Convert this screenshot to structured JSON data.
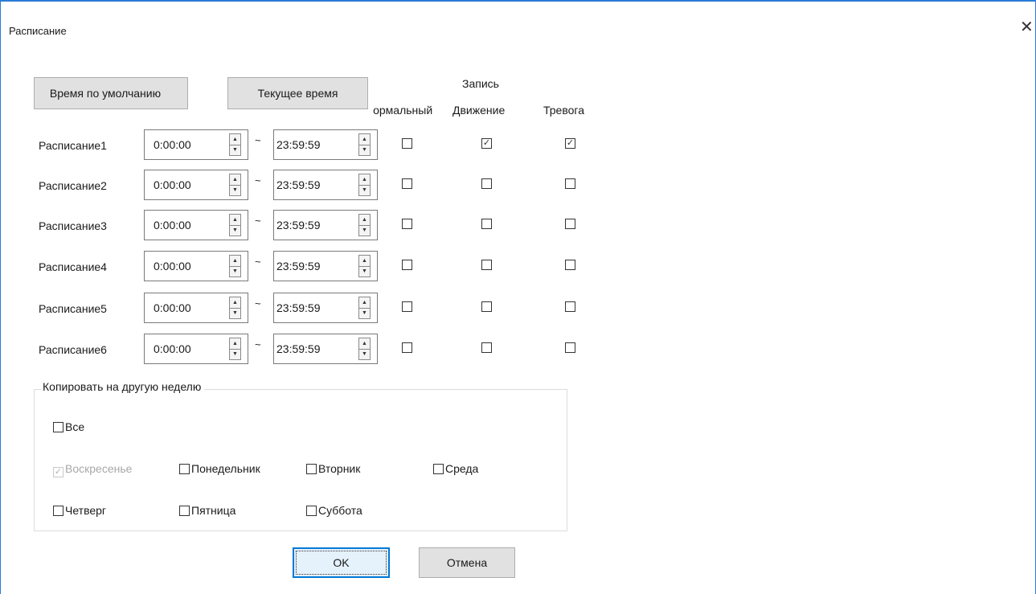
{
  "window": {
    "title": "Расписание",
    "close_glyph": "✕"
  },
  "buttons": {
    "default_time": "Время по умолчанию",
    "current_time": "Текущее время",
    "ok": "OK",
    "cancel": "Отмена"
  },
  "headers": {
    "record": "Запись",
    "normal": "Нормальный",
    "motion": "Движение",
    "alarm": "Тревога"
  },
  "separator": "~",
  "schedules": [
    {
      "label": "Расписание1",
      "start": "0:00:00",
      "end": "23:59:59",
      "normal": false,
      "motion": true,
      "alarm": true
    },
    {
      "label": "Расписание2",
      "start": "0:00:00",
      "end": "23:59:59",
      "normal": false,
      "motion": false,
      "alarm": false
    },
    {
      "label": "Расписание3",
      "start": "0:00:00",
      "end": "23:59:59",
      "normal": false,
      "motion": false,
      "alarm": false
    },
    {
      "label": "Расписание4",
      "start": "0:00:00",
      "end": "23:59:59",
      "normal": false,
      "motion": false,
      "alarm": false
    },
    {
      "label": "Расписание5",
      "start": "0:00:00",
      "end": "23:59:59",
      "normal": false,
      "motion": false,
      "alarm": false
    },
    {
      "label": "Расписание6",
      "start": "0:00:00",
      "end": "23:59:59",
      "normal": false,
      "motion": false,
      "alarm": false
    }
  ],
  "copy": {
    "title": "Копировать на другую неделю",
    "all": {
      "label": "Все",
      "checked": false
    },
    "days": [
      {
        "label": "Воскресенье",
        "checked": true,
        "disabled": true
      },
      {
        "label": "Понедельник",
        "checked": false,
        "disabled": false
      },
      {
        "label": "Вторник",
        "checked": false,
        "disabled": false
      },
      {
        "label": "Среда",
        "checked": false,
        "disabled": false
      },
      {
        "label": "Четверг",
        "checked": false,
        "disabled": false
      },
      {
        "label": "Пятница",
        "checked": false,
        "disabled": false
      },
      {
        "label": "Суббота",
        "checked": false,
        "disabled": false
      }
    ]
  },
  "icons": {
    "close": "close-icon",
    "spin_up": "arrow-up-icon",
    "spin_down": "arrow-down-icon",
    "check": "checkmark-icon"
  }
}
